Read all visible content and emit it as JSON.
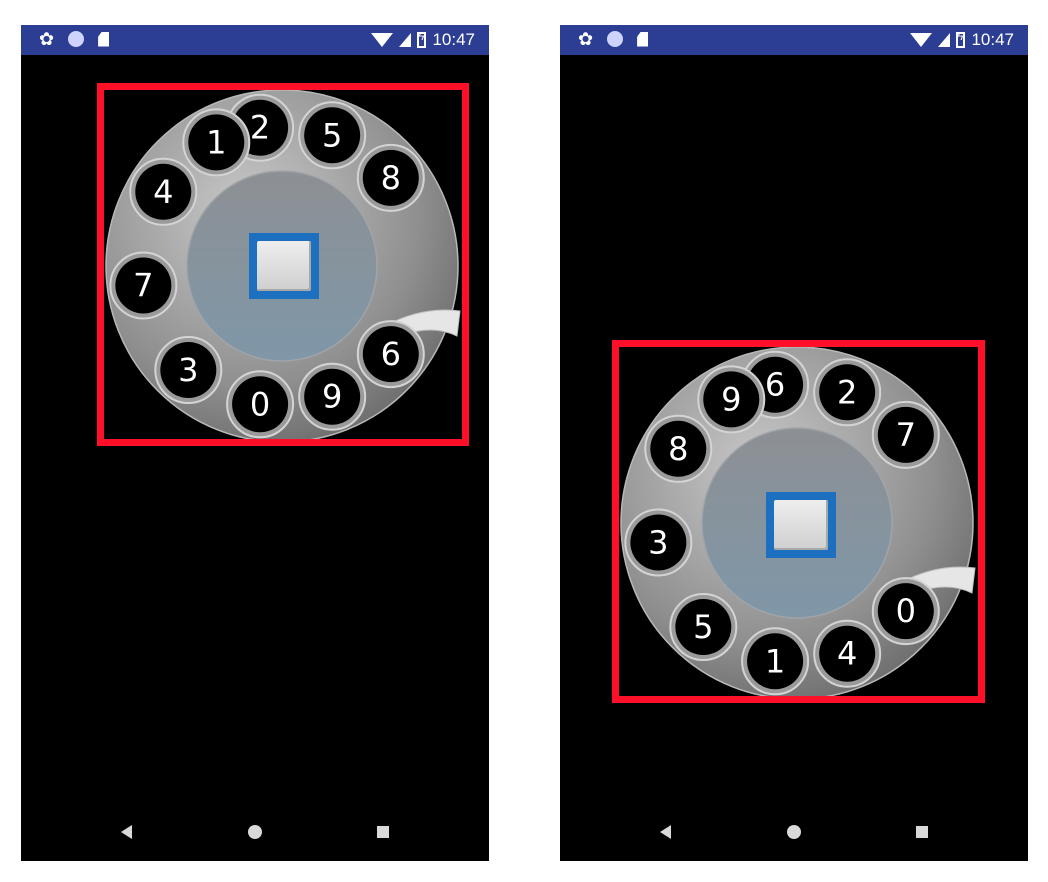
{
  "status_bar": {
    "time": "10:47"
  },
  "screens": [
    {
      "name": "left",
      "digits": [
        "2",
        "5",
        "8",
        "6",
        "9",
        "0",
        "3",
        "7",
        "4",
        "1"
      ]
    },
    {
      "name": "right",
      "digits": [
        "6",
        "2",
        "7",
        "0",
        "4",
        "1",
        "5",
        "3",
        "8",
        "9"
      ]
    }
  ],
  "colors": {
    "status_bar": "#2c3e94",
    "highlight_red": "#ff1028",
    "highlight_blue": "#1d6fbf"
  },
  "icons": [
    "gear-icon",
    "circle-icon",
    "sd-card-icon",
    "wifi-icon",
    "signal-icon",
    "battery-icon",
    "back-icon",
    "home-icon",
    "recents-icon"
  ]
}
